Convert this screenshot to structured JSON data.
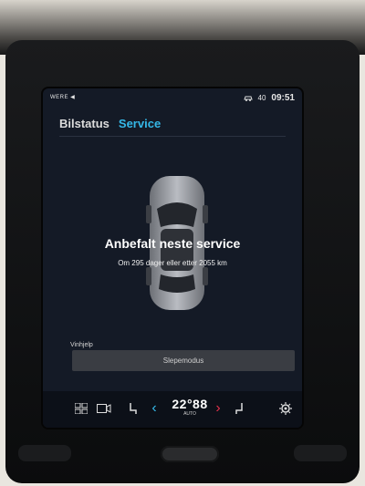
{
  "status_bar": {
    "left_text": "WERE ◀",
    "right_icons": [
      "car-link-icon",
      "signal-icon"
    ],
    "right_text": "40",
    "time": "09:51"
  },
  "tabs": [
    {
      "label": "Bilstatus",
      "active": false
    },
    {
      "label": "Service",
      "active": true
    }
  ],
  "service": {
    "headline": "Anbefalt neste service",
    "detail": "Om 295 dager eller etter 2055 km"
  },
  "tow": {
    "help_label": "Vinhjelp",
    "button_label": "Slepemodus"
  },
  "climate": {
    "temperature": "22°88",
    "mode": "AUTO"
  },
  "colors": {
    "accent": "#35b8e8",
    "screen_bg": "#141a26",
    "button_bg": "#3a3d43"
  }
}
